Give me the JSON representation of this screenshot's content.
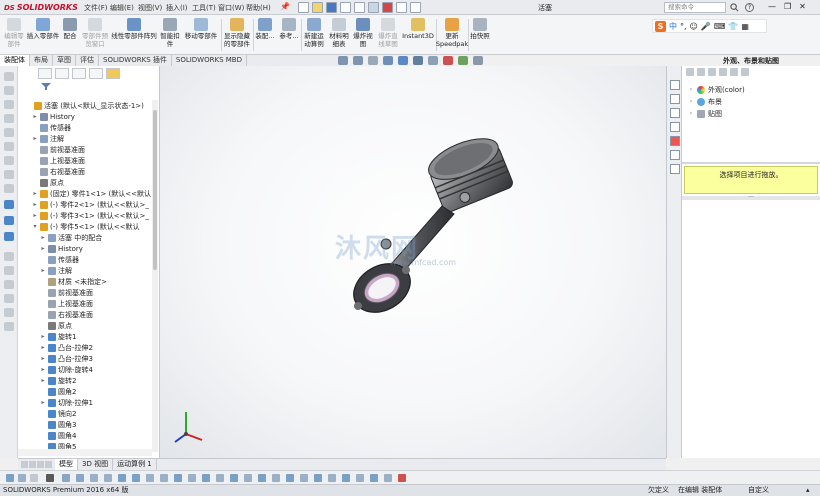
{
  "app": {
    "logo_text": "SOLIDWORKS",
    "logo_prefix": "DS",
    "document_title": "活塞",
    "search_placeholder": "搜索命令"
  },
  "menu": [
    "文件(F)",
    "编辑(E)",
    "视图(V)",
    "插入(I)",
    "工具(T)",
    "窗口(W)",
    "帮助(H)"
  ],
  "window_buttons": [
    "—",
    "❐",
    "✕"
  ],
  "ime": {
    "logo": "S",
    "items": [
      "中",
      "°,",
      "☺",
      "🎤",
      "⌨",
      "👕",
      "▦"
    ]
  },
  "commands": [
    {
      "label": "编辑零\n部件",
      "disabled": true
    },
    {
      "label": "插入零部件",
      "disabled": false
    },
    {
      "label": "配合",
      "disabled": false
    },
    {
      "label": "零部件预\n览窗口",
      "disabled": true
    },
    {
      "label": "线性零部件阵列",
      "disabled": false
    },
    {
      "label": "智能扣\n件",
      "disabled": false
    },
    {
      "label": "移动零部件",
      "disabled": false
    },
    {
      "label": "显示隐藏\n的零部件",
      "disabled": false
    },
    {
      "label": "装配...",
      "disabled": false
    },
    {
      "label": "参考...",
      "disabled": false
    },
    {
      "label": "新建运\n动算例",
      "disabled": false
    },
    {
      "label": "材料明\n细表",
      "disabled": false
    },
    {
      "label": "爆炸视\n图",
      "disabled": false
    },
    {
      "label": "爆炸直\n线草图",
      "disabled": true
    },
    {
      "label": "Instant3D",
      "disabled": false
    },
    {
      "label": "更新\nSpeedpak",
      "disabled": false
    },
    {
      "label": "拍快照",
      "disabled": false
    }
  ],
  "tabs": [
    "装配体",
    "布局",
    "草图",
    "评估",
    "SOLIDWORKS 插件",
    "SOLIDWORKS MBD"
  ],
  "active_tab": 0,
  "feature_tree": [
    {
      "label": "活塞 (默认<默认_显示状态-1>)",
      "level": 0,
      "arrow": "",
      "icon": "#e0a020"
    },
    {
      "label": "History",
      "level": 1,
      "arrow": "▸",
      "icon": "#7d8fa8"
    },
    {
      "label": "传感器",
      "level": 1,
      "arrow": "",
      "icon": "#8aa0c0"
    },
    {
      "label": "注解",
      "level": 1,
      "arrow": "▸",
      "icon": "#8aa0c0"
    },
    {
      "label": "前视基准面",
      "level": 1,
      "arrow": "",
      "icon": "#9aa4b0"
    },
    {
      "label": "上视基准面",
      "level": 1,
      "arrow": "",
      "icon": "#9aa4b0"
    },
    {
      "label": "右视基准面",
      "level": 1,
      "arrow": "",
      "icon": "#9aa4b0"
    },
    {
      "label": "原点",
      "level": 1,
      "arrow": "",
      "icon": "#7a7a7a"
    },
    {
      "label": "(固定) 零件1<1> (默认<<默认",
      "level": 1,
      "arrow": "▸",
      "icon": "#e0a020"
    },
    {
      "label": "(-) 零件2<1> (默认<<默认>_",
      "level": 1,
      "arrow": "▸",
      "icon": "#e0a020"
    },
    {
      "label": "(-) 零件3<1> (默认<<默认>_",
      "level": 1,
      "arrow": "▸",
      "icon": "#e0a020"
    },
    {
      "label": "(-) 零件5<1> (默认<<默认",
      "level": 1,
      "arrow": "▾",
      "icon": "#e0a020"
    },
    {
      "label": "活塞 中的配合",
      "level": 2,
      "arrow": "▸",
      "icon": "#8aa0c0"
    },
    {
      "label": "History",
      "level": 2,
      "arrow": "▸",
      "icon": "#7d8fa8"
    },
    {
      "label": "传感器",
      "level": 2,
      "arrow": "",
      "icon": "#8aa0c0"
    },
    {
      "label": "注解",
      "level": 2,
      "arrow": "▸",
      "icon": "#8aa0c0"
    },
    {
      "label": "材质 <未指定>",
      "level": 2,
      "arrow": "",
      "icon": "#b0a080"
    },
    {
      "label": "前视基准面",
      "level": 2,
      "arrow": "",
      "icon": "#9aa4b0"
    },
    {
      "label": "上视基准面",
      "level": 2,
      "arrow": "",
      "icon": "#9aa4b0"
    },
    {
      "label": "右视基准面",
      "level": 2,
      "arrow": "",
      "icon": "#9aa4b0"
    },
    {
      "label": "原点",
      "level": 2,
      "arrow": "",
      "icon": "#7a7a7a"
    },
    {
      "label": "旋转1",
      "level": 2,
      "arrow": "▸",
      "icon": "#4a86c8"
    },
    {
      "label": "凸台-拉伸2",
      "level": 2,
      "arrow": "▸",
      "icon": "#4a86c8"
    },
    {
      "label": "凸台-拉伸3",
      "level": 2,
      "arrow": "▸",
      "icon": "#4a86c8"
    },
    {
      "label": "切除-旋转4",
      "level": 2,
      "arrow": "▸",
      "icon": "#4a86c8"
    },
    {
      "label": "旋转2",
      "level": 2,
      "arrow": "▸",
      "icon": "#4a86c8"
    },
    {
      "label": "圆角2",
      "level": 2,
      "arrow": "",
      "icon": "#4a86c8"
    },
    {
      "label": "切除-拉伸1",
      "level": 2,
      "arrow": "▸",
      "icon": "#4a86c8"
    },
    {
      "label": "镜向2",
      "level": 2,
      "arrow": "",
      "icon": "#4a86c8"
    },
    {
      "label": "圆角3",
      "level": 2,
      "arrow": "",
      "icon": "#4a86c8"
    },
    {
      "label": "圆角4",
      "level": 2,
      "arrow": "",
      "icon": "#4a86c8"
    },
    {
      "label": "圆角5",
      "level": 2,
      "arrow": "",
      "icon": "#4a86c8"
    }
  ],
  "watermark": {
    "text": "沐风网",
    "url": "www.mfcad.com"
  },
  "task_pane": {
    "title": "外观、布景和贴图",
    "items": [
      "外观(color)",
      "布景",
      "贴图"
    ],
    "message": "选择项目进行拖放。"
  },
  "bottom_tabs": [
    "模型",
    "3D 视图",
    "运动算例 1"
  ],
  "status": {
    "left": "SOLIDWORKS Premium 2016 x64 版",
    "mid1": "欠定义",
    "mid2": "在编辑 装配体",
    "mid3": "自定义"
  },
  "colors": {
    "accent": "#c8102e",
    "message_bg": "#fbff9d"
  }
}
